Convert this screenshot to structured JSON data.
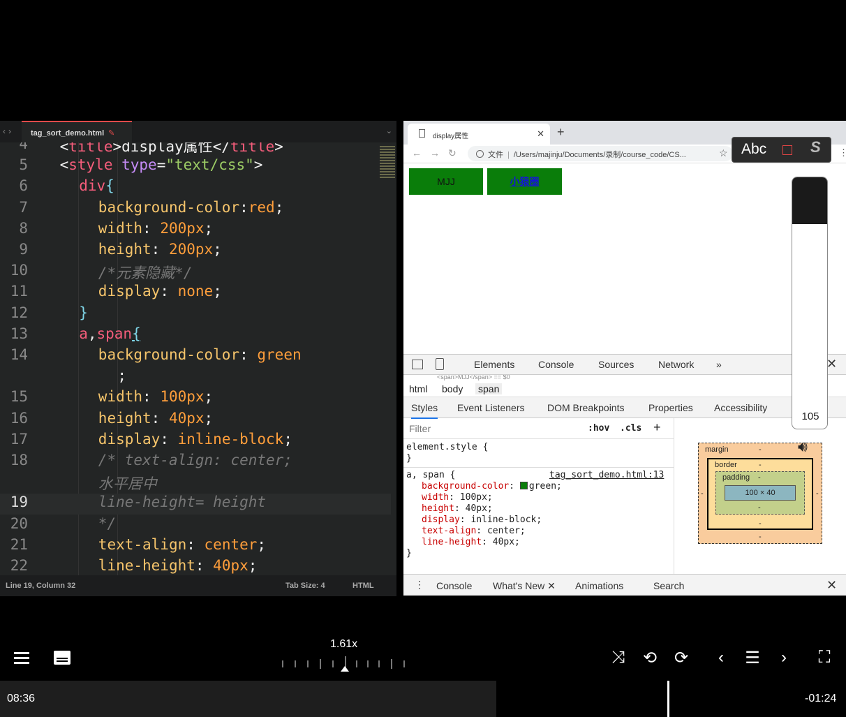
{
  "editor": {
    "tab_title": "tag_sort_demo.html",
    "dirty_mark": "✎",
    "status": {
      "position": "Line 19, Column 32",
      "tab_size": "Tab Size: 4",
      "syntax": "HTML"
    },
    "lines": [
      {
        "num": "4",
        "html": "<span class='k-punc'>&lt;</span><span class='k-tag'>title</span><span class='k-punc'>&gt;display属性&lt;/</span><span class='k-tag'>title</span><span class='k-punc'>&gt;</span>",
        "indent": 2
      },
      {
        "num": "5",
        "html": "<span class='k-punc'>&lt;</span><span class='k-tag'>style</span> <span class='k-attr'>type</span><span class='k-punc'>=</span><span class='k-str'>\"text/css\"</span><span class='k-punc'>&gt;</span>",
        "indent": 2
      },
      {
        "num": "6",
        "html": "<span class='k-tag'>div</span><span class='k-brace'>{</span>",
        "indent": 4
      },
      {
        "num": "7",
        "html": "<span class='k-prop'>background-color</span><span class='k-punc'>:</span><span class='k-val'>red</span><span class='k-punc'>;</span>",
        "indent": 6
      },
      {
        "num": "8",
        "html": "<span class='k-prop'>width</span><span class='k-punc'>: </span><span class='k-val'>200px</span><span class='k-punc'>;</span>",
        "indent": 6
      },
      {
        "num": "9",
        "html": "<span class='k-prop'>height</span><span class='k-punc'>: </span><span class='k-val'>200px</span><span class='k-punc'>;</span>",
        "indent": 6
      },
      {
        "num": "10",
        "html": "<span class='k-com'>/*元素隐藏*/</span>",
        "indent": 6
      },
      {
        "num": "11",
        "html": "<span class='k-prop'>display</span><span class='k-punc'>: </span><span class='k-val'>none</span><span class='k-punc'>;</span>",
        "indent": 6
      },
      {
        "num": "12",
        "html": "<span class='k-brace'>}</span>",
        "indent": 4
      },
      {
        "num": "13",
        "html": "<span class='k-tag'>a</span><span class='k-punc'>,</span><span class='k-tag'>span</span><span class='k-brace' style='text-decoration:underline'>{</span>",
        "indent": 4
      },
      {
        "num": "14",
        "html": "<span class='k-prop'>background-color</span><span class='k-punc'>: </span><span class='k-val'>green</span>",
        "indent": 6
      },
      {
        "num": "",
        "html": "<span class='k-punc'>;</span>",
        "indent": 8
      },
      {
        "num": "15",
        "html": "<span class='k-prop'>width</span><span class='k-punc'>: </span><span class='k-val'>100px</span><span class='k-punc'>;</span>",
        "indent": 6
      },
      {
        "num": "16",
        "html": "<span class='k-prop'>height</span><span class='k-punc'>: </span><span class='k-val'>40px</span><span class='k-punc'>;</span>",
        "indent": 6
      },
      {
        "num": "17",
        "html": "<span class='k-prop'>display</span><span class='k-punc'>: </span><span class='k-val'>inline-block</span><span class='k-punc'>;</span>",
        "indent": 6
      },
      {
        "num": "18",
        "html": "<span class='k-com'>/* text-align: center;</span>",
        "indent": 6
      },
      {
        "num": "",
        "html": "<span class='k-com'>水平居中</span>",
        "indent": 6
      },
      {
        "num": "19",
        "html": "<span class='k-com'>line-height= height</span>",
        "indent": 6,
        "current": true
      },
      {
        "num": "20",
        "html": "<span class='k-com'>*/</span>",
        "indent": 6
      },
      {
        "num": "21",
        "html": "<span class='k-prop'>text-align</span><span class='k-punc'>: </span><span class='k-val'>center</span><span class='k-punc'>;</span>",
        "indent": 6
      },
      {
        "num": "22",
        "html": "<span class='k-prop'>line-height</span><span class='k-punc'>: </span><span class='k-val'>40px</span><span class='k-punc'>;</span>",
        "indent": 6
      }
    ]
  },
  "browser": {
    "tab_title": "display属性",
    "url_prefix": "文件",
    "url": "/Users/majinju/Documents/录制/course_code/CS...",
    "boxes": [
      "MJJ",
      "小猿圈"
    ],
    "devtools": {
      "tabs": [
        "Elements",
        "Console",
        "Sources",
        "Network",
        "»"
      ],
      "breadcrumb": [
        "html",
        "body",
        "span"
      ],
      "scrolled_line": "<span>MJJ</span> == $0",
      "subtabs": [
        "Styles",
        "Event Listeners",
        "DOM Breakpoints",
        "Properties",
        "Accessibility"
      ],
      "filter_placeholder": "Filter",
      "hov": ":hov",
      "cls": ".cls",
      "element_style": "element.style {",
      "close_brace": "}",
      "rule_selector": "a, span {",
      "rule_source": "tag_sort_demo.html:13",
      "declarations": [
        {
          "name": "background-color",
          "value": "green;"
        },
        {
          "name": "width",
          "value": "100px;"
        },
        {
          "name": "height",
          "value": "40px;"
        },
        {
          "name": "display",
          "value": "inline-block;"
        },
        {
          "name": "text-align",
          "value": "center;"
        },
        {
          "name": "line-height",
          "value": "40px;"
        }
      ],
      "box_model": {
        "margin": "margin",
        "border": "border",
        "padding": "padding",
        "content": "100 × 40",
        "dash": "-"
      },
      "drawer_tabs": [
        "Console",
        "What's New",
        "Animations",
        "Search"
      ]
    }
  },
  "ime": {
    "label": "Abc"
  },
  "volume": {
    "value": "105",
    "level_percent": 80
  },
  "player": {
    "speed": "1.61x",
    "elapsed": "08:36",
    "remaining": "-01:24",
    "progress_fraction": 0.79
  }
}
